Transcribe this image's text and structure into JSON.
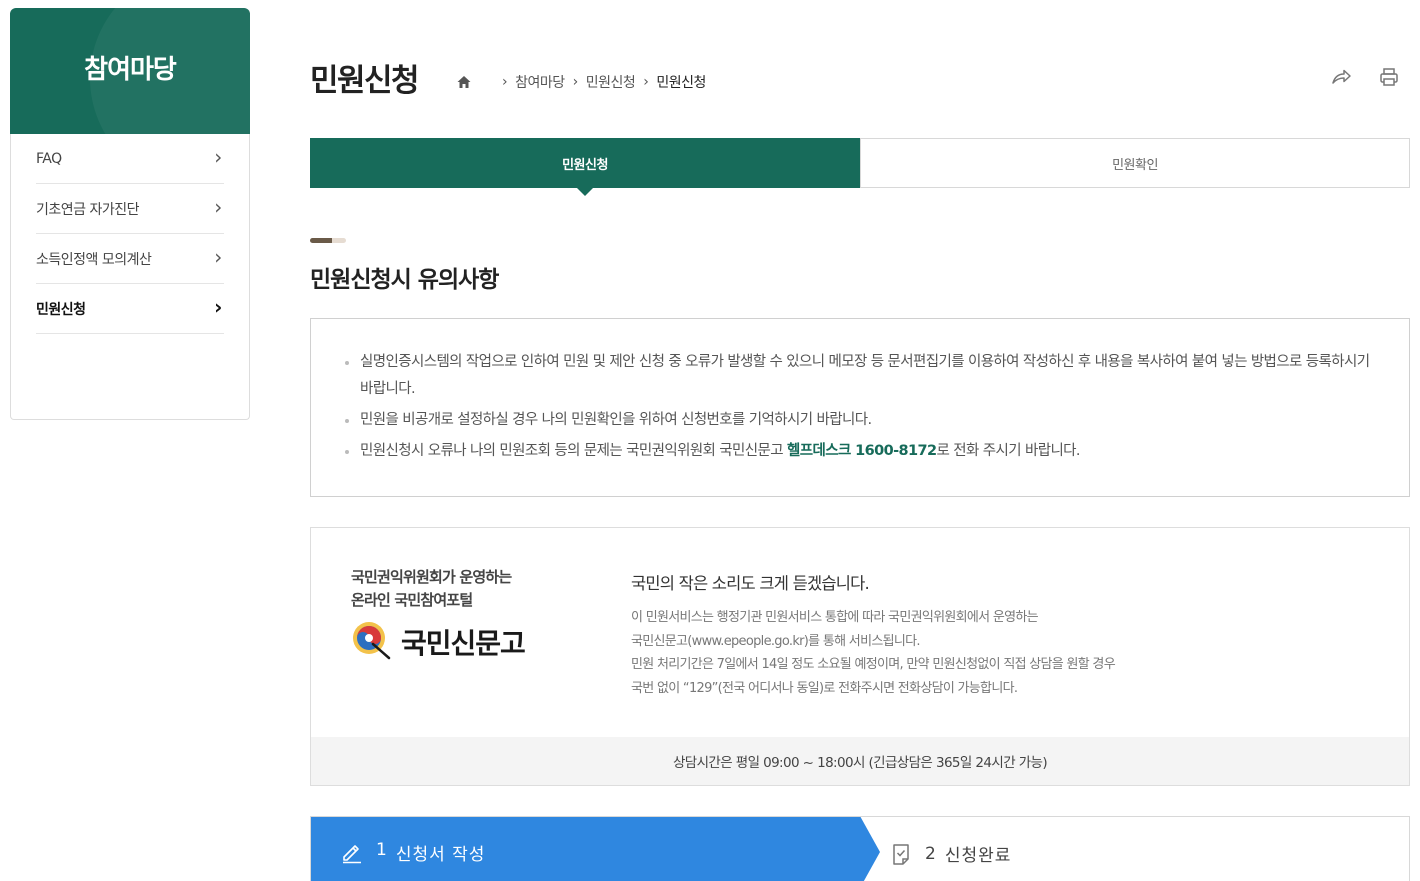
{
  "sidebar": {
    "title": "참여마당",
    "items": [
      {
        "label": "FAQ"
      },
      {
        "label": "기초연금 자가진단"
      },
      {
        "label": "소득인정액 모의계산"
      },
      {
        "label": "민원신청"
      }
    ],
    "active_index": 3
  },
  "header": {
    "title": "민원신청",
    "breadcrumb": [
      "참여마당",
      "민원신청",
      "민원신청"
    ],
    "actions": [
      "share-icon",
      "print-icon"
    ]
  },
  "tabs": [
    {
      "label": "민원신청",
      "active": true
    },
    {
      "label": "민원확인",
      "active": false
    }
  ],
  "section": {
    "title": "민원신청시 유의사항"
  },
  "notice": {
    "items": [
      "실명인증시스템의 작업으로 인하여 민원 및 제안 신청 중 오류가 발생할 수 있으니 메모장 등 문서편집기를 이용하여 작성하신 후 내용을 복사하여 붙여 넣는 방법으로 등록하시기 바랍니다.",
      "민원을 비공개로 설정하실 경우 나의 민원확인을 위하여 신청번호를 기억하시기 바랍니다."
    ],
    "item3_prefix": "민원신청시 오류나 나의 민원조회 등의 문제는 국민권익위원회 국민신문고 ",
    "item3_highlight": "헬프데스크 1600-8172",
    "item3_suffix": "로 전화 주시기 바랍니다."
  },
  "info": {
    "tag_line1": "국민권익위원회가 운영하는",
    "tag_line2": "온라인 국민참여포털",
    "logo_text": "국민신문고",
    "headline": "국민의 작은 소리도 크게 듣겠습니다.",
    "body_lines": [
      "이 민원서비스는 행정기관 민원서비스 통합에 따라 국민권익위원회에서 운영하는",
      "국민신문고(www.epeople.go.kr)를 통해 서비스됩니다.",
      "민원 처리기간은 7일에서 14일 정도 소요될 예정이며, 만약 민원신청없이 직접 상담을 원할 경우",
      "국번 없이 “129”(전국 어디서나 동일)로 전화주시면 전화상담이 가능합니다."
    ],
    "footer": "상담시간은 평일 09:00 ~ 18:00시 (긴급상담은 365일 24시간 가능)"
  },
  "steps": [
    {
      "num": "1",
      "label": "신청서 작성",
      "icon": "pencil-icon",
      "active": true
    },
    {
      "num": "2",
      "label": "신청완료",
      "icon": "document-check-icon",
      "active": false
    }
  ],
  "colors": {
    "primary": "#176b5a",
    "step_active": "#2f87e0",
    "deco_dark": "#6a5a48",
    "deco_light": "#e6dcd2"
  }
}
